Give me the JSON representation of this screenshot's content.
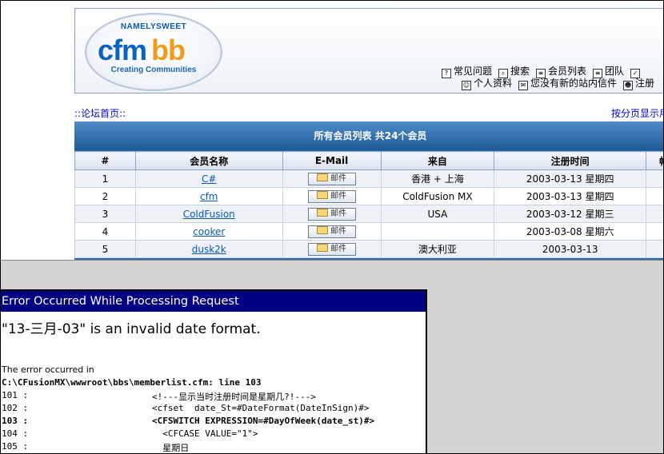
{
  "header": {
    "logo_top": "NAMELYSWEET",
    "logo_main_1": "cfm",
    "logo_main_2": "bb",
    "logo_sub": "Creating Communities",
    "nav_row1": [
      {
        "label": "常见问题",
        "icon": "help-icon"
      },
      {
        "label": "搜索",
        "icon": "search-icon"
      },
      {
        "label": "会员列表",
        "icon": "list-icon"
      },
      {
        "label": "团队",
        "icon": "team-icon"
      },
      {
        "label": "",
        "icon": "checkbox-icon"
      }
    ],
    "nav_row2": [
      {
        "label": "个人资料",
        "icon": "profile-icon"
      },
      {
        "label": "您没有新的站内信件",
        "icon": "message-icon"
      },
      {
        "label": "注册",
        "icon": "register-icon"
      }
    ]
  },
  "breadcrumb": "::论坛首页::",
  "pager": "按分页显示用户",
  "members": {
    "title": "所有会员列表 共24个会员",
    "columns": [
      "#",
      "会员名称",
      "E-Mail",
      "来自",
      "注册时间",
      "帖"
    ],
    "mail_label": "邮件",
    "rows": [
      {
        "num": "1",
        "name": "C#",
        "from": "香港 + 上海",
        "date": "2003-03-13 星期四"
      },
      {
        "num": "2",
        "name": "cfm",
        "from": "ColdFusion MX",
        "date": "2003-03-13 星期四"
      },
      {
        "num": "3",
        "name": "ColdFusion",
        "from": "USA",
        "date": "2003-03-12 星期三"
      },
      {
        "num": "4",
        "name": "cooker",
        "from": "",
        "date": "2003-03-08 星期六"
      },
      {
        "num": "5",
        "name": "dusk2k",
        "from": "澳大利亚",
        "date": "2003-03-13"
      }
    ]
  },
  "error": {
    "title": "Error Occurred While Processing Request",
    "message": "\"13-三月-03\" is an invalid date format.",
    "occurred": "The error occurred in",
    "path": "C:\\CFusionMX\\wwwroot\\bbs\\memberlist.cfm: line 103",
    "code_lines": [
      {
        "num": "101 :",
        "text": "<!---显示当时注册时间是星期几?!--->",
        "bold": false
      },
      {
        "num": "102 :",
        "text": "<cfset  date_St=#DateFormat(DateInSign)#>",
        "bold": false
      },
      {
        "num": "103 :",
        "text": "<CFSWITCH EXPRESSION=#DayOfWeek(date_st)#>",
        "bold": true
      },
      {
        "num": "104 :",
        "text": "  <CFCASE VALUE=\"1\">",
        "bold": false
      },
      {
        "num": "105 :",
        "text": "  星期日",
        "bold": false
      }
    ]
  }
}
